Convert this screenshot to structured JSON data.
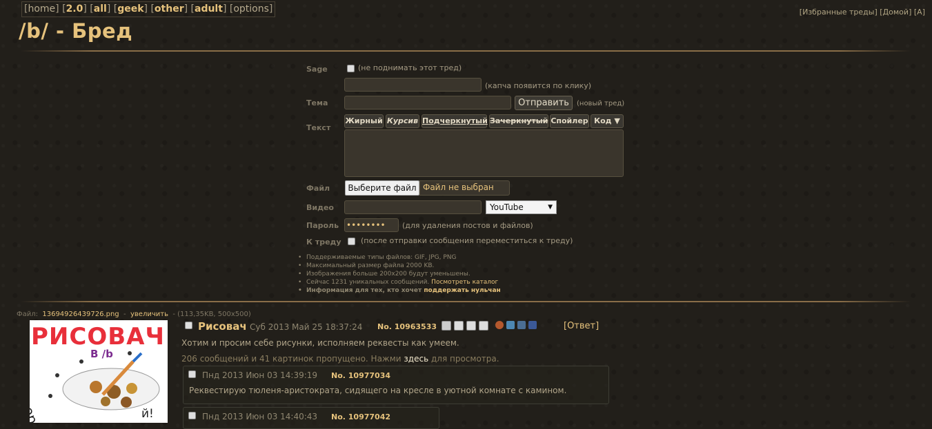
{
  "nav": {
    "items": [
      {
        "label": "home",
        "style": "plain"
      },
      {
        "label": "2.0",
        "style": "bold"
      },
      {
        "label": "all",
        "style": "bold"
      },
      {
        "label": "geek",
        "style": "bold"
      },
      {
        "label": "other",
        "style": "bold"
      },
      {
        "label": "adult",
        "style": "bold"
      },
      {
        "label": "options",
        "style": "plain"
      }
    ],
    "right": [
      "Избранные треды",
      "Домой",
      "A"
    ]
  },
  "board": {
    "title": "/b/ - Бред"
  },
  "form": {
    "sage_label": "Sage",
    "sage_hint": "(не поднимать этот тред)",
    "captcha_hint": "(капча появится по клику)",
    "subject_label": "Тема",
    "submit_label": "Отправить",
    "submit_hint": "(новый тред)",
    "text_label": "Текст",
    "markup_buttons": [
      "Жирный",
      "Курсив",
      "Подчеркнутый",
      "Зачеркнутый",
      "Спойлер",
      "Код ▼"
    ],
    "file_label": "Файл",
    "file_button": "Выберите файл",
    "file_status": "Файл не выбран",
    "video_label": "Видео",
    "video_select": "YouTube",
    "password_label": "Пароль",
    "password_value": "••••••••",
    "password_hint": "(для удаления постов и файлов)",
    "tothread_label": "К треду",
    "tothread_hint": "(после отправки сообщения переместиться к треду)"
  },
  "rules": {
    "types": "Поддерживаемые типы файлов: GIF, JPG, PNG",
    "maxsize": "Максимальный размер файла 2000 KB.",
    "resize": "Изображения больше 200x200 будут уменьшены.",
    "unique_prefix": "Сейчас 1231 уникальных сообщений.",
    "catalog_link": "Посмотреть каталог",
    "donate_prefix": "Информация для тех, кто хочет",
    "donate_link": "поддержать нульчан"
  },
  "thread": {
    "file_prefix": "Файл:",
    "file_name": "13694926439726.png",
    "file_sep": "-",
    "enlarge": "увеличить",
    "file_meta": "- (113,35KB, 500x500)",
    "thumb_text": "РИСОВАЧ",
    "thumb_sub": "В /b",
    "thumb_bottom": "пор",
    "thumb_bottom_right": "й!",
    "op": {
      "name": "Рисовач",
      "date": "Суб 2013 Май 25 18:37:24",
      "no": "No. 10963533",
      "reply_link": "Ответ",
      "text": "Хотим и просим себе рисунки, исполняем реквесты как умеем."
    },
    "omitted_prefix": "206 сообщений и 41 картинок пропущено. Нажми",
    "omitted_link": "здесь",
    "omitted_suffix": "для просмотра.",
    "replies": [
      {
        "date": "Пнд 2013 Июн 03 14:39:19",
        "no": "No. 10977034",
        "text": "Реквестирую тюленя-аристократа, сидящего на кресле в уютной комнате с камином."
      },
      {
        "date": "Пнд 2013 Июн 03 14:40:43",
        "no": "No. 10977042",
        "text": ""
      }
    ]
  },
  "colors": {
    "accent": "#e6c27c",
    "text": "#a59b84",
    "background": "#221f1a"
  }
}
